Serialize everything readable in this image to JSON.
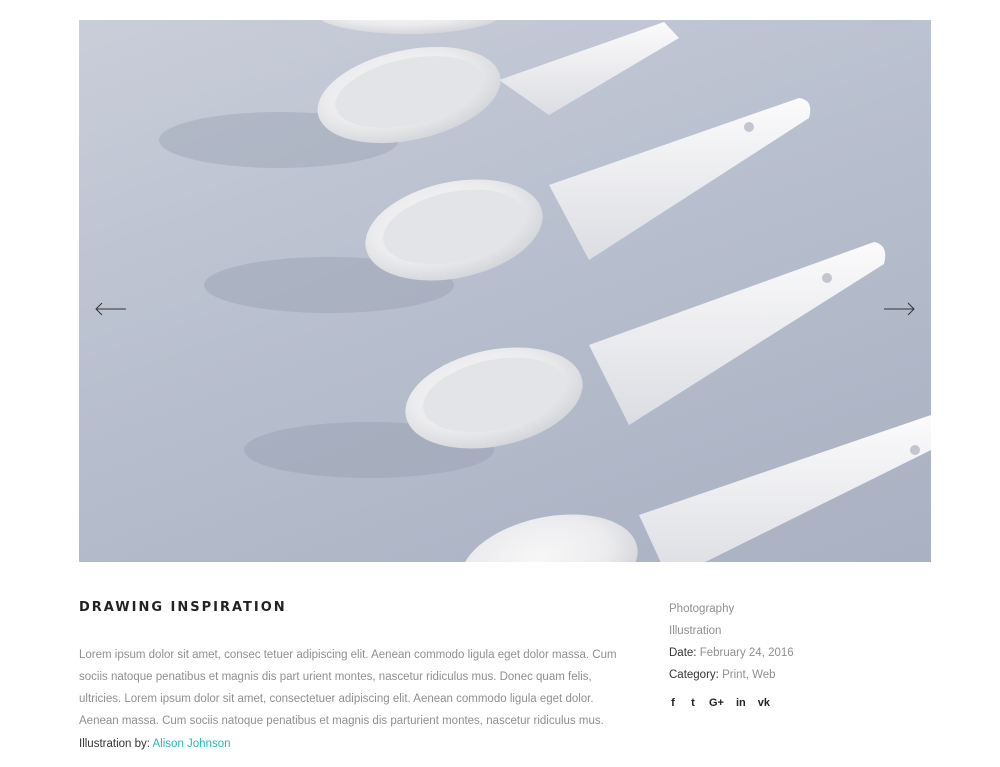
{
  "slider": {
    "image_alt": "White porcelain spoons on a pale blue surface",
    "prev_icon": "arrow-left-icon",
    "next_icon": "arrow-right-icon"
  },
  "project": {
    "title": "DRAWING INSPIRATION",
    "description": "Lorem ipsum dolor sit amet, consec tetuer adipiscing elit. Aenean commodo ligula eget dolor massa. Cum sociis natoque penatibus et magnis dis part urient montes, nascetur ridiculus mus. Donec quam felis, ultricies. Lorem ipsum dolor sit amet, consectetuer adipiscing elit. Aenean commodo ligula eget dolor. Aenean massa. Cum sociis natoque penatibus et magnis dis parturient montes, nascetur ridiculus mus.",
    "credit_label": "Illustration by:",
    "credit_name": "Alison Johnson"
  },
  "meta": {
    "tags": [
      "Photography",
      "Illustration"
    ],
    "date_label": "Date:",
    "date_value": "February 24, 2016",
    "category_label": "Category:",
    "categories": [
      "Print",
      "Web"
    ]
  },
  "social": [
    {
      "icon": "facebook-icon",
      "glyph": "f"
    },
    {
      "icon": "twitter-icon",
      "glyph": "t"
    },
    {
      "icon": "google-plus-icon",
      "glyph": "G+"
    },
    {
      "icon": "linkedin-icon",
      "glyph": "in"
    },
    {
      "icon": "vk-icon",
      "glyph": "vk"
    }
  ],
  "colors": {
    "accent": "#26b8b8",
    "heading": "#222222",
    "text": "#8f8f8f",
    "photo_bg": "#b8bfce"
  }
}
